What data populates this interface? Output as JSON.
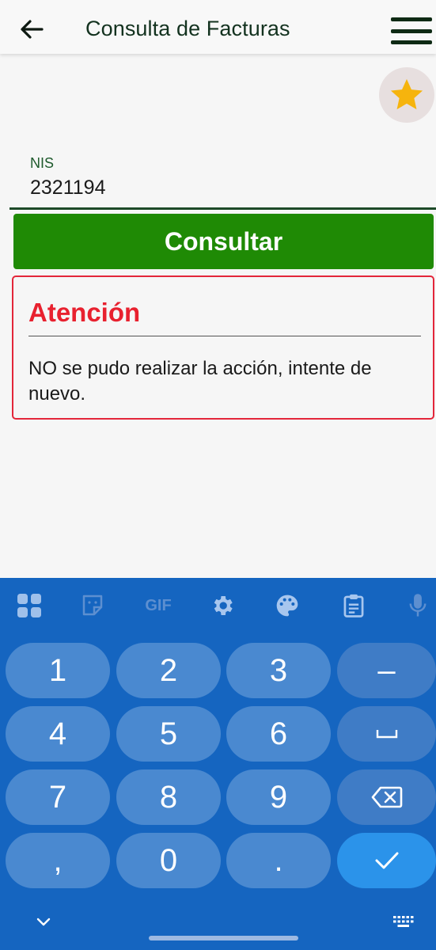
{
  "app": {
    "title": "Consulta de Facturas"
  },
  "form": {
    "nis_label": "NIS",
    "nis_value": "2321194",
    "consult_label": "Consultar"
  },
  "alert": {
    "title": "Atención",
    "message": "NO se pudo realizar la acción, intente de nuevo."
  },
  "keyboard": {
    "toolbar": [
      "apps-grid-icon",
      "sticker-icon",
      "gif-icon",
      "settings-icon",
      "palette-icon",
      "clipboard-icon",
      "microphone-icon"
    ],
    "gif_label": "GIF",
    "keys": {
      "k1": "1",
      "k2": "2",
      "k3": "3",
      "minus": "–",
      "k4": "4",
      "k5": "5",
      "k6": "6",
      "k7": "7",
      "k8": "8",
      "k9": "9",
      "comma": ",",
      "k0": "0",
      "dot": "."
    }
  },
  "colors": {
    "primary_green": "#1f8a05",
    "alert_red": "#e3263a",
    "keyboard_blue": "#1565c0",
    "star": "#f6b40d"
  }
}
